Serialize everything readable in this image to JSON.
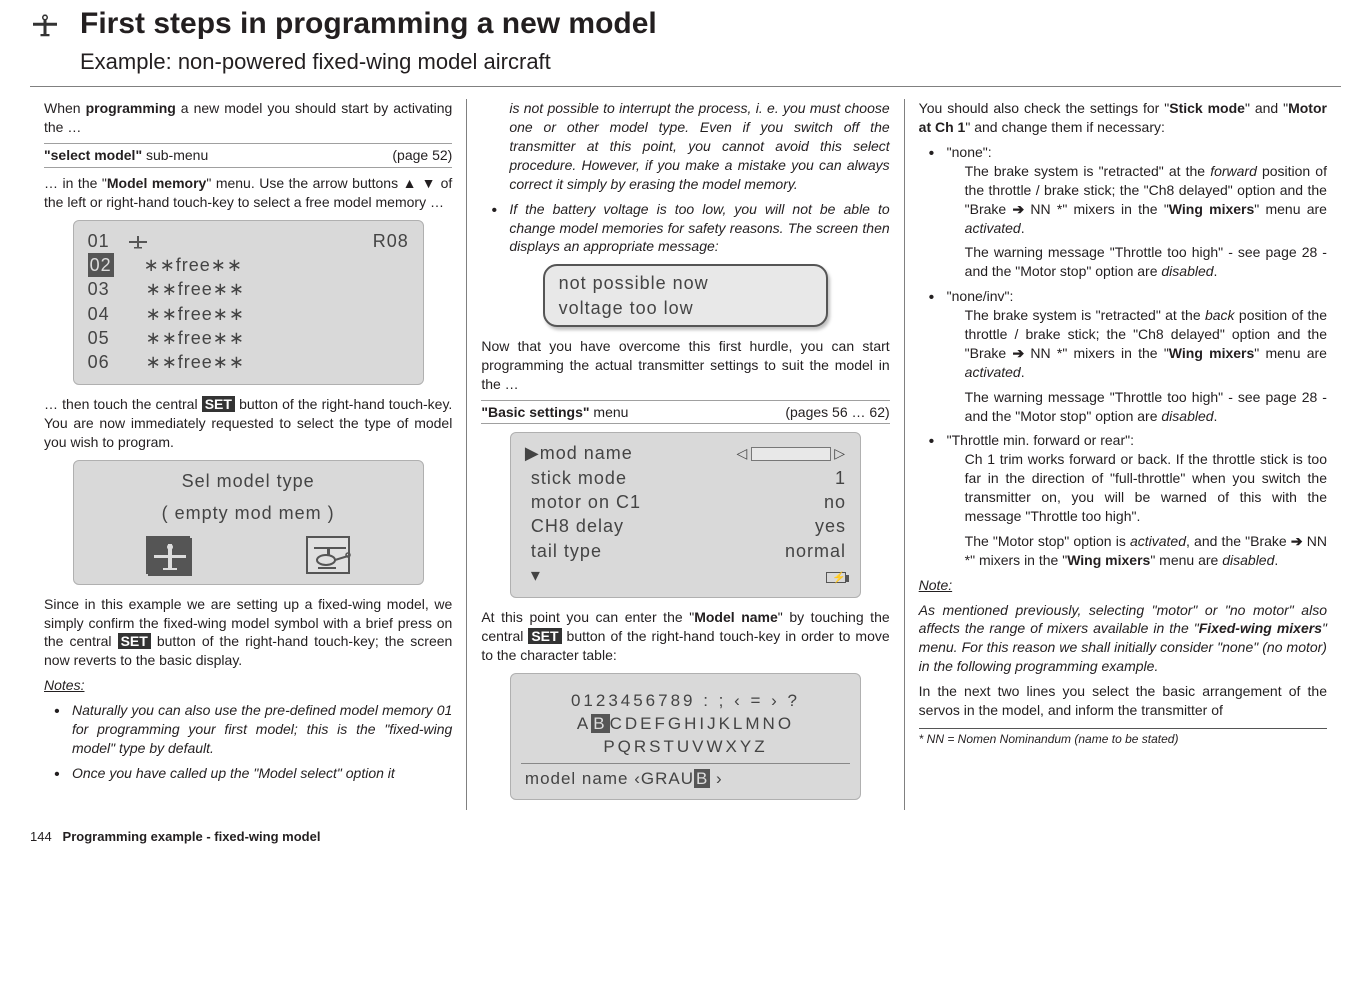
{
  "header": {
    "title": "First steps in programming a new model",
    "subtitle": "Example: non-powered fixed-wing model aircraft"
  },
  "col1": {
    "p1a": "When ",
    "p1b": "programming",
    "p1c": " a new model you should start by activating the …",
    "m1": {
      "label": "\"select model\"",
      "sub": " sub-menu",
      "page": "(page 52)"
    },
    "p2a": "… in the \"",
    "p2b": "Model memory",
    "p2c": "\" menu. Use the arrow buttons ▲ ▼ of the left or right-hand touch-key to select a free model memory …",
    "screen1": {
      "r1l": "01",
      "r1r": "R08",
      "r2": "02",
      "r2t": "∗∗free∗∗",
      "r3": "03",
      "r3t": "∗∗free∗∗",
      "r4": "04",
      "r4t": "∗∗free∗∗",
      "r5": "05",
      "r5t": "∗∗free∗∗",
      "r6": "06",
      "r6t": "∗∗free∗∗"
    },
    "p3a": "… then touch the central ",
    "p3set": "SET",
    "p3b": " button of the right-hand touch-key. You are now immediately requested to select the type of model you wish to program.",
    "screen2": {
      "l1": "Sel  model  type",
      "l2": "( empty  mod  mem )"
    },
    "p4a": "Since in this example we are setting up a fixed-wing model, we simply confirm the fixed-wing model symbol with a brief press on the central ",
    "p4b": " button of the right-hand touch-key; the screen now reverts to the basic display.",
    "notesTitle": "Notes:",
    "n1": "Naturally you can also use the pre-defined model memory 01 for programming your first model; this is the \"fixed-wing model\" type by default.",
    "n2": "Once you have called up the \"Model select\" option it"
  },
  "col2": {
    "n2cont": "is not possible to interrupt the process, i. e. you must choose one or other model type. Even if you switch off the transmitter at this point, you cannot avoid this select procedure. However, if you make a mistake you can always correct it simply by erasing the model memory.",
    "n3": "If the battery voltage is too low, you will not be able to change model memories for safety reasons. The screen then displays an appropriate message:",
    "msg": {
      "l1": "not  possible  now",
      "l2": "voltage  too  low"
    },
    "p1": "Now that you have overcome this first hurdle, you can start programming the actual transmitter settings to suit the model in the …",
    "m2": {
      "label": "\"Basic settings\"",
      "sub": " menu",
      "page": "(pages 56 … 62)"
    },
    "screen3": {
      "r1l": "mod  name",
      "r1r": "",
      "r2l": "stick  mode",
      "r2r": "1",
      "r3l": "motor  on  C1",
      "r3r": "no",
      "r4l": "CH8  delay",
      "r4r": "yes",
      "r5l": "tail  type",
      "r5r": "normal"
    },
    "p2a": "At this point you can enter the \"",
    "p2b": "Model name",
    "p2c": "\" by touching the central ",
    "p2d": " button of the right-hand touch-key in order to move to the character table:",
    "charScreen": {
      "l1": "0123456789 : ; ‹ = › ?",
      "l2a": " A",
      "l2hl": "B",
      "l2b": "CDEFGHIJKLMNO",
      "l3": "PQRSTUVWXYZ",
      "bottomL": "model  name ",
      "bottomM": "‹GRAU",
      "bottomHl": "B",
      "bottomR": "     ›"
    }
  },
  "col3": {
    "p1a": "You should also check the settings for \"",
    "p1b": "Stick mode",
    "p1c": "\" and \"",
    "p1d": "Motor at Ch 1",
    "p1e": "\" and change them if necessary:",
    "b1": "\"none\":",
    "b1p1a": "The brake system is \"retracted\" at the ",
    "b1p1i": "forward",
    "b1p1b": " position of the throttle / brake stick; the \"Ch8 delayed\" option and the \"Brake ",
    "b1arrow": "➔",
    "b1p1c": " NN *\" mixers in the \"",
    "b1p1d": "Wing mixers",
    "b1p1e": "\" menu are ",
    "b1p1f": "activated",
    "b1p1g": ".",
    "b1p2a": "The warning message \"Throttle too high\" - see page 28 - and the \"Motor stop\" option are ",
    "b1p2b": "disabled",
    "b1p2c": ".",
    "b2": "\"none/inv\":",
    "b2p1a": "The brake system is \"retracted\" at the ",
    "b2p1i": "back",
    "b2p1b": " position of the throttle / brake stick; the \"Ch8 delayed\" option and the \"Brake ",
    "b2p1c": " NN *\" mixers in the \"",
    "b2p1d": "Wing mixers",
    "b2p1e": "\" menu are ",
    "b2p1f": "activated",
    "b2p1g": ".",
    "b2p2a": "The warning message \"Throttle too high\" - see page 28 - and the \"Motor stop\" option are ",
    "b2p2b": "disabled",
    "b2p2c": ".",
    "b3": "\"Throttle min. forward or rear\":",
    "b3p1": "Ch 1 trim works forward or back. If the throttle stick is too far in the direction of \"full-throttle\" when you switch the transmitter on, you will be warned of this with the message \"Throttle too high\".",
    "b3p2a": "The \"Motor stop\" option is ",
    "b3p2b": "activated",
    "b3p2c": ", and the \"Brake ",
    "b3p2d": " NN *\" mixers in the \"",
    "b3p2e": "Wing mixers",
    "b3p2f": "\" menu are ",
    "b3p2g": "disabled",
    "b3p2h": ".",
    "noteTitle": "Note:",
    "notea": "As mentioned previously, selecting \"motor\" or \"no motor\" also affects the range of mixers available in the \"",
    "noteb": "Fixed-wing mixers",
    "notec": "\" menu. For this reason we shall initially consider \"none\" (no motor) in the following programming example.",
    "p2": "In the next two lines you select the basic arrangement of the servos in the model, and inform the transmitter of",
    "footnote": "*    NN = Nomen Nominandum (name to be stated)"
  },
  "footer": {
    "page": "144",
    "label": "Programming example - fixed-wing model"
  }
}
